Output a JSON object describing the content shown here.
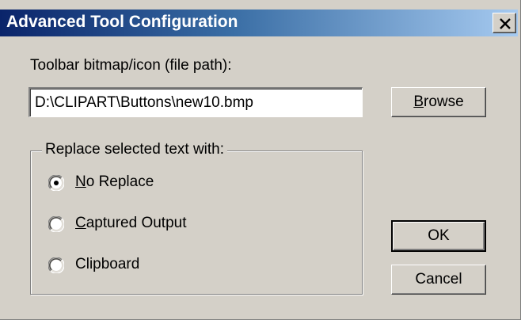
{
  "window": {
    "title": "Advanced Tool Configuration",
    "close_label": "Close"
  },
  "bitmap": {
    "label": "Toolbar bitmap/icon (file path):",
    "value": "D:\\CLIPART\\Buttons\\new10.bmp"
  },
  "buttons": {
    "browse_mnemonic": "B",
    "browse_rest": "rowse",
    "ok": "OK",
    "cancel": "Cancel"
  },
  "replace_group": {
    "legend": "Replace selected text with:",
    "options": [
      {
        "mnemonic": "N",
        "rest": "o Replace",
        "selected": true
      },
      {
        "mnemonic": "C",
        "rest": "aptured Output",
        "selected": false
      },
      {
        "mnemonic": "",
        "rest": "Clipboard",
        "selected": false
      }
    ]
  },
  "colors": {
    "dialog_bg": "#d4d0c8",
    "title_gradient_start": "#0a246a",
    "title_gradient_end": "#a6caf0",
    "title_text": "#ffffff"
  },
  "icons": {
    "close": "close-icon"
  }
}
